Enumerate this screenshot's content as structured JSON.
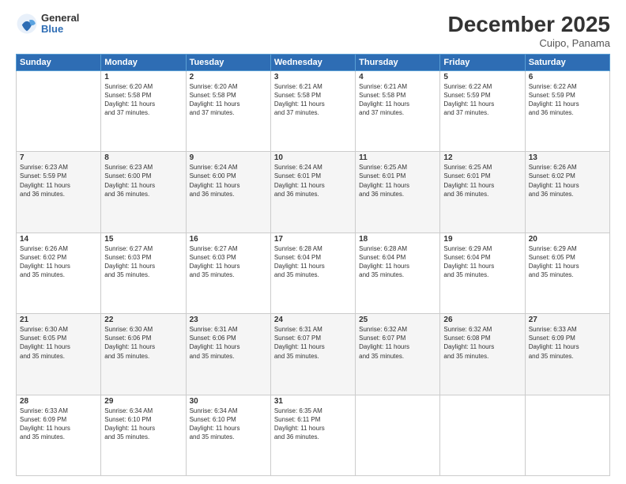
{
  "header": {
    "logo_general": "General",
    "logo_blue": "Blue",
    "month_year": "December 2025",
    "location": "Cuipo, Panama"
  },
  "days_of_week": [
    "Sunday",
    "Monday",
    "Tuesday",
    "Wednesday",
    "Thursday",
    "Friday",
    "Saturday"
  ],
  "weeks": [
    [
      {
        "day": "",
        "info": ""
      },
      {
        "day": "1",
        "info": "Sunrise: 6:20 AM\nSunset: 5:58 PM\nDaylight: 11 hours\nand 37 minutes."
      },
      {
        "day": "2",
        "info": "Sunrise: 6:20 AM\nSunset: 5:58 PM\nDaylight: 11 hours\nand 37 minutes."
      },
      {
        "day": "3",
        "info": "Sunrise: 6:21 AM\nSunset: 5:58 PM\nDaylight: 11 hours\nand 37 minutes."
      },
      {
        "day": "4",
        "info": "Sunrise: 6:21 AM\nSunset: 5:58 PM\nDaylight: 11 hours\nand 37 minutes."
      },
      {
        "day": "5",
        "info": "Sunrise: 6:22 AM\nSunset: 5:59 PM\nDaylight: 11 hours\nand 37 minutes."
      },
      {
        "day": "6",
        "info": "Sunrise: 6:22 AM\nSunset: 5:59 PM\nDaylight: 11 hours\nand 36 minutes."
      }
    ],
    [
      {
        "day": "7",
        "info": "Sunrise: 6:23 AM\nSunset: 5:59 PM\nDaylight: 11 hours\nand 36 minutes."
      },
      {
        "day": "8",
        "info": "Sunrise: 6:23 AM\nSunset: 6:00 PM\nDaylight: 11 hours\nand 36 minutes."
      },
      {
        "day": "9",
        "info": "Sunrise: 6:24 AM\nSunset: 6:00 PM\nDaylight: 11 hours\nand 36 minutes."
      },
      {
        "day": "10",
        "info": "Sunrise: 6:24 AM\nSunset: 6:01 PM\nDaylight: 11 hours\nand 36 minutes."
      },
      {
        "day": "11",
        "info": "Sunrise: 6:25 AM\nSunset: 6:01 PM\nDaylight: 11 hours\nand 36 minutes."
      },
      {
        "day": "12",
        "info": "Sunrise: 6:25 AM\nSunset: 6:01 PM\nDaylight: 11 hours\nand 36 minutes."
      },
      {
        "day": "13",
        "info": "Sunrise: 6:26 AM\nSunset: 6:02 PM\nDaylight: 11 hours\nand 36 minutes."
      }
    ],
    [
      {
        "day": "14",
        "info": "Sunrise: 6:26 AM\nSunset: 6:02 PM\nDaylight: 11 hours\nand 35 minutes."
      },
      {
        "day": "15",
        "info": "Sunrise: 6:27 AM\nSunset: 6:03 PM\nDaylight: 11 hours\nand 35 minutes."
      },
      {
        "day": "16",
        "info": "Sunrise: 6:27 AM\nSunset: 6:03 PM\nDaylight: 11 hours\nand 35 minutes."
      },
      {
        "day": "17",
        "info": "Sunrise: 6:28 AM\nSunset: 6:04 PM\nDaylight: 11 hours\nand 35 minutes."
      },
      {
        "day": "18",
        "info": "Sunrise: 6:28 AM\nSunset: 6:04 PM\nDaylight: 11 hours\nand 35 minutes."
      },
      {
        "day": "19",
        "info": "Sunrise: 6:29 AM\nSunset: 6:04 PM\nDaylight: 11 hours\nand 35 minutes."
      },
      {
        "day": "20",
        "info": "Sunrise: 6:29 AM\nSunset: 6:05 PM\nDaylight: 11 hours\nand 35 minutes."
      }
    ],
    [
      {
        "day": "21",
        "info": "Sunrise: 6:30 AM\nSunset: 6:05 PM\nDaylight: 11 hours\nand 35 minutes."
      },
      {
        "day": "22",
        "info": "Sunrise: 6:30 AM\nSunset: 6:06 PM\nDaylight: 11 hours\nand 35 minutes."
      },
      {
        "day": "23",
        "info": "Sunrise: 6:31 AM\nSunset: 6:06 PM\nDaylight: 11 hours\nand 35 minutes."
      },
      {
        "day": "24",
        "info": "Sunrise: 6:31 AM\nSunset: 6:07 PM\nDaylight: 11 hours\nand 35 minutes."
      },
      {
        "day": "25",
        "info": "Sunrise: 6:32 AM\nSunset: 6:07 PM\nDaylight: 11 hours\nand 35 minutes."
      },
      {
        "day": "26",
        "info": "Sunrise: 6:32 AM\nSunset: 6:08 PM\nDaylight: 11 hours\nand 35 minutes."
      },
      {
        "day": "27",
        "info": "Sunrise: 6:33 AM\nSunset: 6:09 PM\nDaylight: 11 hours\nand 35 minutes."
      }
    ],
    [
      {
        "day": "28",
        "info": "Sunrise: 6:33 AM\nSunset: 6:09 PM\nDaylight: 11 hours\nand 35 minutes."
      },
      {
        "day": "29",
        "info": "Sunrise: 6:34 AM\nSunset: 6:10 PM\nDaylight: 11 hours\nand 35 minutes."
      },
      {
        "day": "30",
        "info": "Sunrise: 6:34 AM\nSunset: 6:10 PM\nDaylight: 11 hours\nand 35 minutes."
      },
      {
        "day": "31",
        "info": "Sunrise: 6:35 AM\nSunset: 6:11 PM\nDaylight: 11 hours\nand 36 minutes."
      },
      {
        "day": "",
        "info": ""
      },
      {
        "day": "",
        "info": ""
      },
      {
        "day": "",
        "info": ""
      }
    ]
  ]
}
